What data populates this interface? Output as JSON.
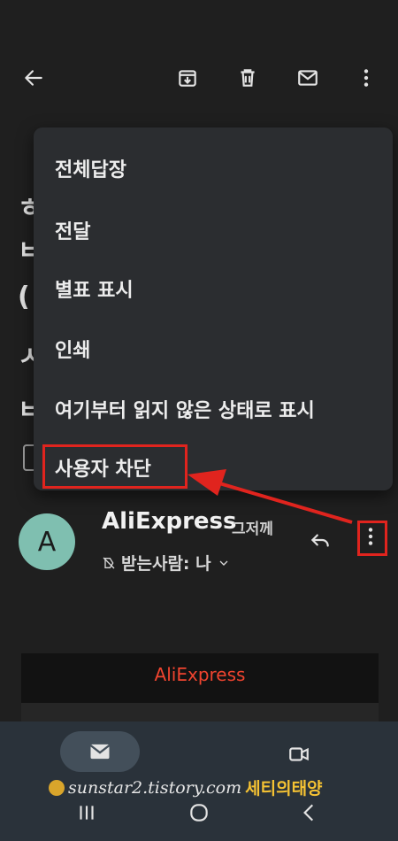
{
  "menu": {
    "items": [
      {
        "label": "전체답장"
      },
      {
        "label": "전달"
      },
      {
        "label": "별표 표시"
      },
      {
        "label": "인쇄"
      },
      {
        "label": "여기부터 읽지 않은 상태로 표시"
      },
      {
        "label": "사용자 차단"
      }
    ]
  },
  "background_glyphs": [
    "ㅎ",
    "ㅂ",
    "(",
    "ㅅ",
    "ㅂ"
  ],
  "sender": {
    "avatar_letter": "A",
    "name": "AliExpress",
    "time": "그저께",
    "recipient": "받는사람: 나"
  },
  "email": {
    "brand": "AliExpress"
  },
  "watermark": {
    "site": "sunstar2.tistory.com",
    "name": "세티의태양"
  },
  "colors": {
    "background": "#1f1f1f",
    "menu": "#2b2d30",
    "highlight": "#e0241e",
    "avatar": "#7fbfb0",
    "brand": "#f0442f",
    "bottom_nav": "#2a323a"
  },
  "icons": [
    "back-arrow-icon",
    "archive-icon",
    "trash-icon",
    "mail-icon",
    "more-vert-icon",
    "reply-icon",
    "muted-label-icon",
    "chevron-down-icon",
    "meet-video-icon",
    "recent-apps-icon",
    "home-icon",
    "back-icon"
  ]
}
